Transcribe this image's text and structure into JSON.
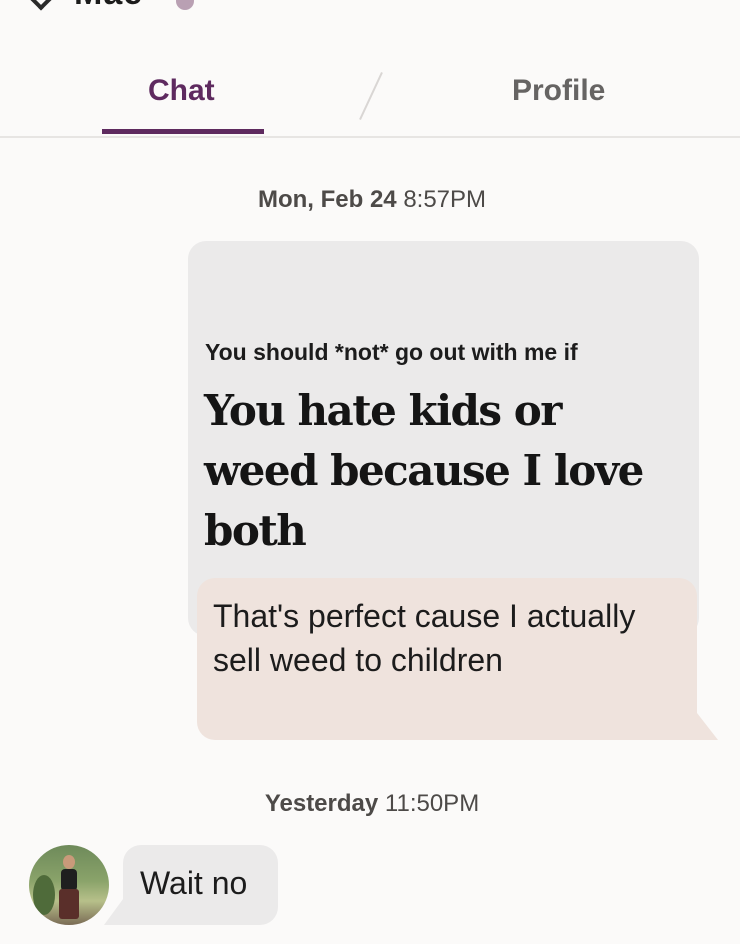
{
  "header": {
    "contact_name": "Mae",
    "verified_icon": "verified-badge-icon",
    "back_icon": "chevron-left-icon"
  },
  "tabs": [
    {
      "label": "Chat",
      "active": true
    },
    {
      "label": "Profile",
      "active": false
    }
  ],
  "colors": {
    "accent": "#5e2a5f",
    "sent_bubble": "#efe3dd",
    "received_bubble": "#ebeaea",
    "background": "#fbfaf9"
  },
  "messages": {
    "timestamp_1": {
      "day": "Mon, Feb 24",
      "time": "8:57PM"
    },
    "prompt": {
      "question": "You should *not* go out with me if",
      "answer": "You hate kids or weed because I love both"
    },
    "reply": "That's perfect cause I actually sell weed to children",
    "timestamp_2": {
      "day": "Yesterday",
      "time": "11:50PM"
    },
    "incoming": "Wait no"
  }
}
